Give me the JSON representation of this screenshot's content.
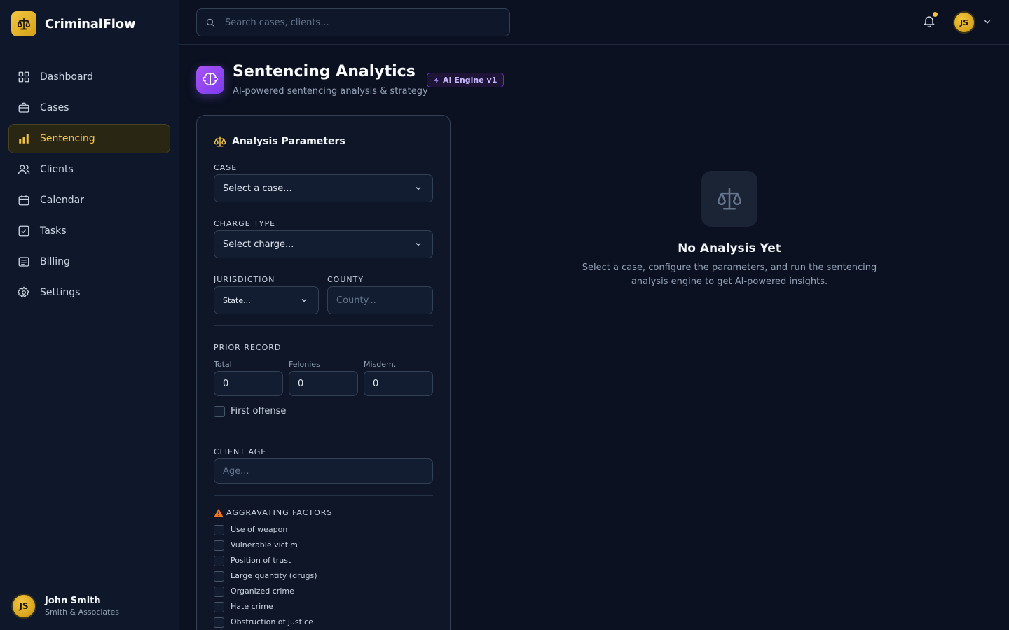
{
  "app": {
    "name": "CriminalFlow"
  },
  "sidebar": {
    "items": [
      {
        "label": "Dashboard",
        "icon": "grid-icon"
      },
      {
        "label": "Cases",
        "icon": "briefcase-icon"
      },
      {
        "label": "Sentencing",
        "icon": "bar-chart-icon",
        "active": true
      },
      {
        "label": "Clients",
        "icon": "users-icon"
      },
      {
        "label": "Calendar",
        "icon": "calendar-icon"
      },
      {
        "label": "Tasks",
        "icon": "checkbox-icon"
      },
      {
        "label": "Billing",
        "icon": "receipt-icon"
      },
      {
        "label": "Settings",
        "icon": "gear-icon"
      }
    ],
    "user": {
      "initials": "JS",
      "name": "John Smith",
      "firm": "Smith & Associates"
    }
  },
  "topbar": {
    "search_placeholder": "Search cases, clients...",
    "avatar_initials": "JS"
  },
  "page": {
    "title": "Sentencing Analytics",
    "subtitle": "AI-powered sentencing analysis & strategy",
    "badge": "AI Engine v1"
  },
  "params": {
    "title": "Analysis Parameters",
    "case_label": "CASE",
    "case_value": "Select a case...",
    "charge_label": "CHARGE TYPE",
    "charge_value": "Select charge...",
    "jurisdiction_label": "JURISDICTION",
    "jurisdiction_value": "State...",
    "county_label": "COUNTY",
    "county_placeholder": "County...",
    "prior_label": "PRIOR RECORD",
    "total_label": "Total",
    "total_value": "0",
    "felonies_label": "Felonies",
    "felonies_value": "0",
    "misdem_label": "Misdem.",
    "misdem_value": "0",
    "first_offense_label": "First offense",
    "age_label": "CLIENT AGE",
    "age_placeholder": "Age...",
    "aggravating_label": "AGGRAVATING FACTORS",
    "aggravating": [
      "Use of weapon",
      "Vulnerable victim",
      "Position of trust",
      "Large quantity (drugs)",
      "Organized crime",
      "Hate crime",
      "Obstruction of justice"
    ]
  },
  "empty": {
    "title": "No Analysis Yet",
    "text": "Select a case, configure the parameters, and run the sentencing analysis engine to get AI-powered insights."
  },
  "colors": {
    "accent": "#f5c542",
    "ai_purple": "#8b5cf6",
    "warning": "#f97316",
    "background": "#0b1120"
  }
}
